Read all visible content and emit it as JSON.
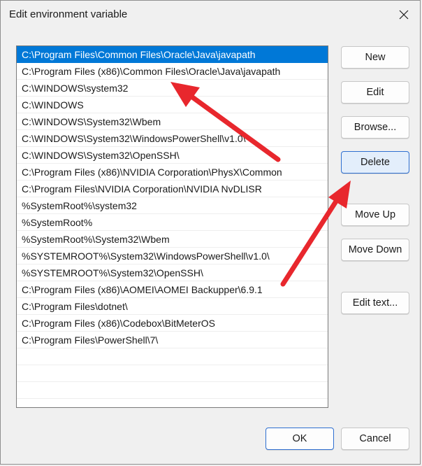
{
  "window": {
    "title": "Edit environment variable"
  },
  "list": {
    "items": [
      "C:\\Program Files\\Common Files\\Oracle\\Java\\javapath",
      "C:\\Program Files (x86)\\Common Files\\Oracle\\Java\\javapath",
      "C:\\WINDOWS\\system32",
      "C:\\WINDOWS",
      "C:\\WINDOWS\\System32\\Wbem",
      "C:\\WINDOWS\\System32\\WindowsPowerShell\\v1.0\\",
      "C:\\WINDOWS\\System32\\OpenSSH\\",
      "C:\\Program Files (x86)\\NVIDIA Corporation\\PhysX\\Common",
      "C:\\Program Files\\NVIDIA Corporation\\NVIDIA NvDLISR",
      "%SystemRoot%\\system32",
      "%SystemRoot%",
      "%SystemRoot%\\System32\\Wbem",
      "%SYSTEMROOT%\\System32\\WindowsPowerShell\\v1.0\\",
      "%SYSTEMROOT%\\System32\\OpenSSH\\",
      "C:\\Program Files (x86)\\AOMEI\\AOMEI Backupper\\6.9.1",
      "C:\\Program Files\\dotnet\\",
      "C:\\Program Files (x86)\\Codebox\\BitMeterOS",
      "C:\\Program Files\\PowerShell\\7\\"
    ],
    "selected_index": 0
  },
  "buttons": {
    "new": "New",
    "edit": "Edit",
    "browse": "Browse...",
    "delete": "Delete",
    "move_up": "Move Up",
    "move_down": "Move Down",
    "edit_text": "Edit text..."
  },
  "footer": {
    "ok": "OK",
    "cancel": "Cancel"
  },
  "colors": {
    "selection": "#0078d7",
    "annotation_arrow": "#e8272d"
  }
}
